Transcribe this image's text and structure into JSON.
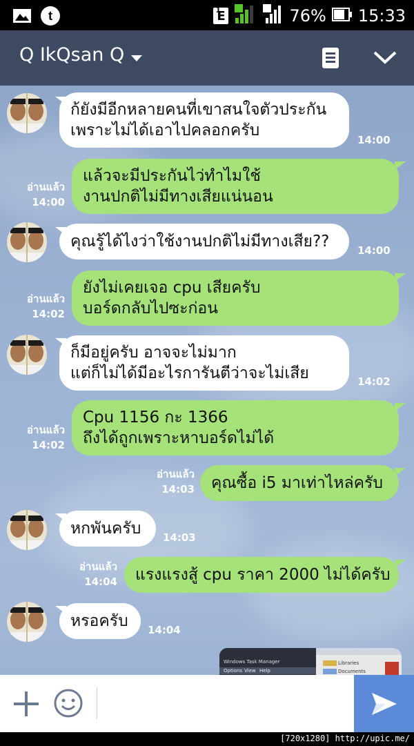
{
  "status_bar": {
    "network_badge": "E",
    "sim1": "1",
    "sim2": "2",
    "battery": "76%",
    "time": "15:33",
    "icons": [
      "gallery-icon",
      "tumblr-icon",
      "signal-icon",
      "battery-icon"
    ]
  },
  "header": {
    "title": "Q IkQsan Q",
    "icons": [
      "dropdown-arrow-icon",
      "note-icon",
      "chevron-down-icon"
    ]
  },
  "messages": [
    {
      "side": "in",
      "lines": [
        "ก้ยังมีอีกหลายคนที่เขาสนใจตัวประกัน",
        "เพราะไม่ได้เอาไปคลอกครับ"
      ],
      "time": "14:00"
    },
    {
      "side": "out",
      "lines": [
        "แล้วจะมีประกันไว่ทำไมใช้",
        "งานปกติไม่มีทางเสียแน่นอน"
      ],
      "read": "อ่านแล้ว",
      "time": "14:00"
    },
    {
      "side": "in",
      "lines": [
        "คุณรู้ได้ไงว่าใช้งานปกติไม่มีทางเสีย??"
      ],
      "time": "14:00"
    },
    {
      "side": "out",
      "lines": [
        "ยังไม่เคยเจอ cpu เสียครับ",
        "บอร์ดกลับไปซะก่อน"
      ],
      "read": "อ่านแล้ว",
      "time": "14:02"
    },
    {
      "side": "in",
      "lines": [
        "ก็มีอยู่ครับ อาจจะไม่มาก",
        "แต่ก็ไม่ได้มีอะไรการันตีว่าจะไม่เสีย"
      ],
      "time": "14:02"
    },
    {
      "side": "out",
      "lines": [
        "Cpu 1156 กะ 1366",
        "ถึงได้ถูกเพราะหาบอร์ดไม่ได้"
      ],
      "read": "อ่านแล้ว",
      "time": "14:02"
    },
    {
      "side": "out",
      "lines": [
        "คุณซื้อ i5 มาเท่าไหล่ครับ"
      ],
      "read": "อ่านแล้ว",
      "time": "14:03"
    },
    {
      "side": "in",
      "lines": [
        "หกพันครับ"
      ],
      "time": "14:03"
    },
    {
      "side": "out",
      "lines": [
        "แรงแรงสู้ cpu ราคา 2000 ไม่ได้ครับ"
      ],
      "read": "อ่านแล้ว",
      "time": "14:04"
    },
    {
      "side": "in",
      "lines": [
        "หรอครับ"
      ],
      "time": "14:04"
    }
  ],
  "image_preview": {
    "label": "Windows Task Manager",
    "menu": [
      "Options",
      "View",
      "Help"
    ],
    "side_items": [
      "Libraries",
      "Documents"
    ]
  },
  "input": {
    "placeholder": "",
    "icons": [
      "plus-icon",
      "emoji-icon",
      "send-icon"
    ]
  },
  "footer": {
    "watermark": "[720x1280] http://upic.me/"
  },
  "colors": {
    "header_bg": "#3d4a62",
    "outgoing_bubble": "#a6e27a",
    "incoming_bubble": "#ffffff",
    "send_button": "#5b8bd8"
  }
}
